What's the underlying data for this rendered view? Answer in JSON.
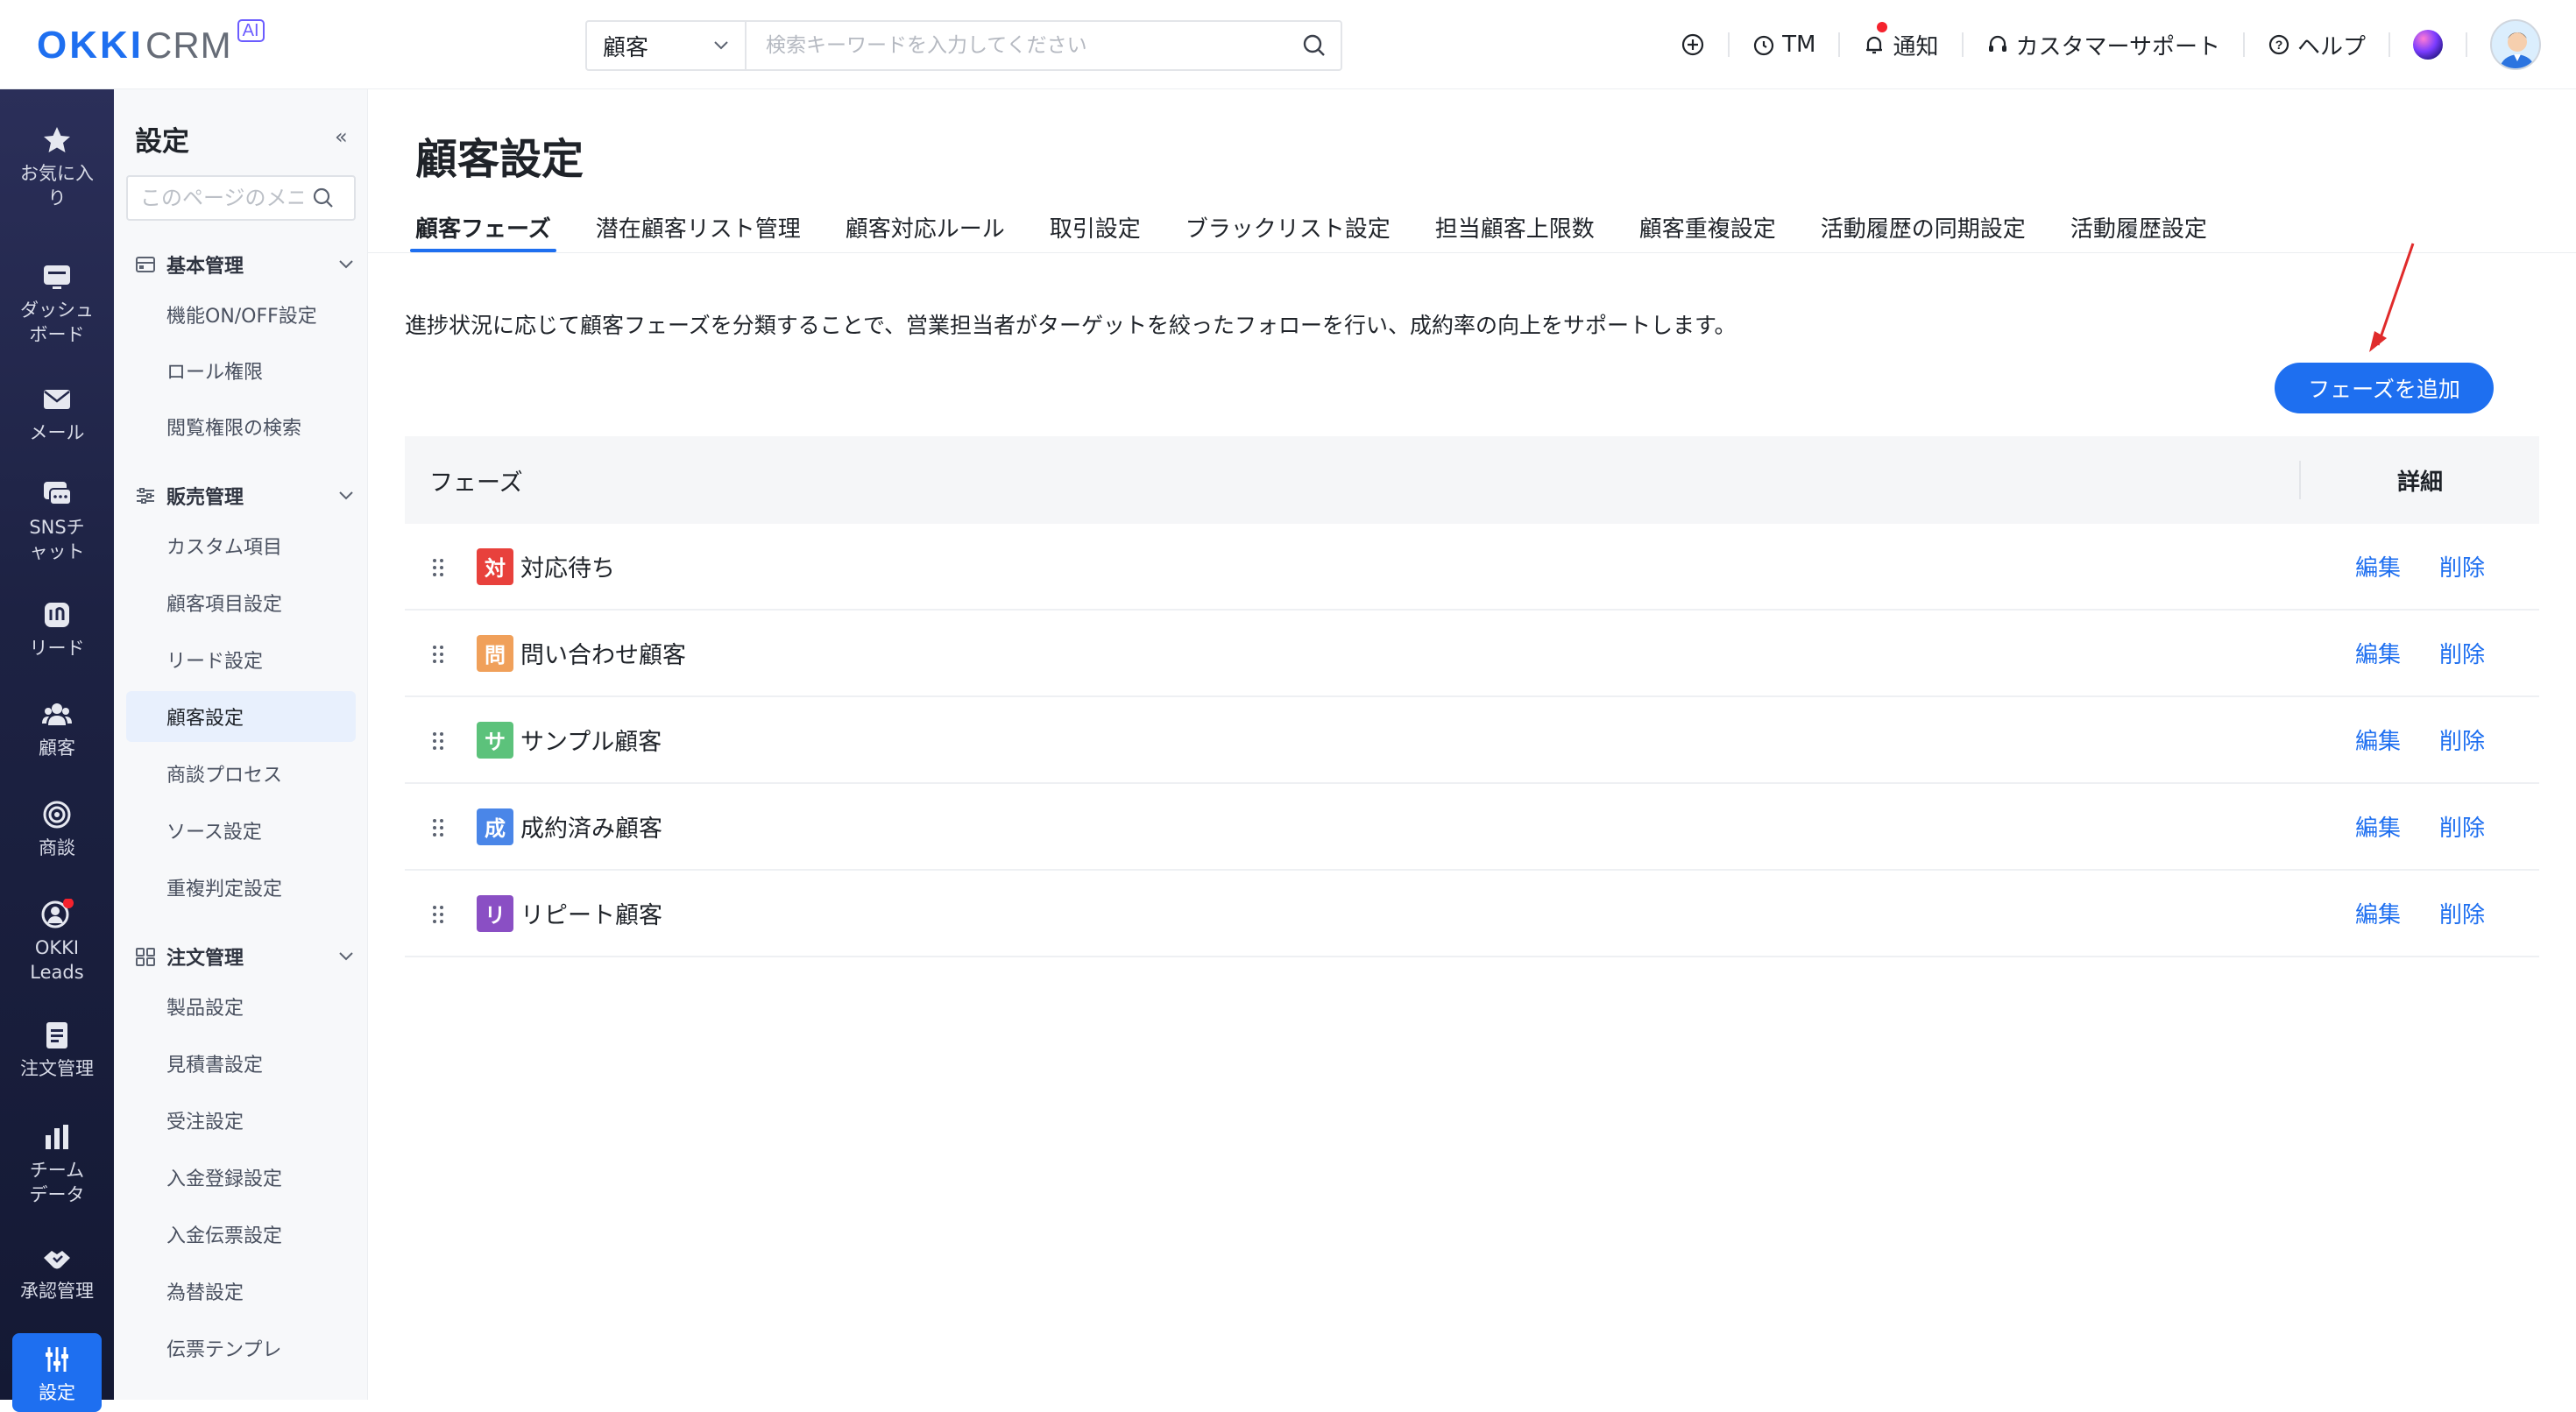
{
  "brand": {
    "okki": "OKKI",
    "crm": "CRM",
    "ai": "AI"
  },
  "search": {
    "type": "顧客",
    "placeholder": "検索キーワードを入力してください"
  },
  "top_actions": {
    "tm": "TM",
    "notify": "通知",
    "support": "カスタマーサポート",
    "help": "ヘルプ"
  },
  "leftnav": [
    {
      "label": "お気に入り",
      "icon": "star-icon"
    },
    {
      "label": "ダッシュボード",
      "icon": "dashboard-icon"
    },
    {
      "label": "メール",
      "icon": "mail-icon"
    },
    {
      "label": "SNSチャット",
      "icon": "chat-icon"
    },
    {
      "label": "リード",
      "icon": "lead-icon"
    },
    {
      "label": "顧客",
      "icon": "customers-icon"
    },
    {
      "label": "商談",
      "icon": "target-icon"
    },
    {
      "label": "OKKI Leads",
      "icon": "okki-leads-icon"
    },
    {
      "label": "注文管理",
      "icon": "order-icon"
    },
    {
      "label": "チームデータ",
      "icon": "team-data-icon"
    },
    {
      "label": "承認管理",
      "icon": "approval-icon"
    },
    {
      "label": "設定",
      "icon": "settings-icon"
    }
  ],
  "subnav": {
    "title": "設定",
    "search_placeholder": "このページのメニュー",
    "groups": [
      {
        "label": "基本管理",
        "items": [
          "機能ON/OFF設定",
          "ロール権限",
          "閲覧権限の検索"
        ]
      },
      {
        "label": "販売管理",
        "items": [
          "カスタム項目",
          "顧客項目設定",
          "リード設定",
          "顧客設定",
          "商談プロセス",
          "ソース設定",
          "重複判定設定"
        ]
      },
      {
        "label": "注文管理",
        "items": [
          "製品設定",
          "見積書設定",
          "受注設定",
          "入金登録設定",
          "入金伝票設定",
          "為替設定",
          "伝票テンプレ"
        ]
      }
    ],
    "active": "顧客設定"
  },
  "page": {
    "title": "顧客設定",
    "tabs": [
      "顧客フェーズ",
      "潜在顧客リスト管理",
      "顧客対応ルール",
      "取引設定",
      "ブラックリスト設定",
      "担当顧客上限数",
      "顧客重複設定",
      "活動履歴の同期設定",
      "活動履歴設定"
    ],
    "active_tab": "顧客フェーズ",
    "description": "進捗状況に応じて顧客フェーズを分類することで、営業担当者がターゲットを絞ったフォローを行い、成約率の向上をサポートします。",
    "add_button": "フェーズを追加"
  },
  "table": {
    "col_phase": "フェーズ",
    "col_detail": "詳細",
    "edit_label": "編集",
    "delete_label": "削除",
    "rows": [
      {
        "badge": "対",
        "name": "対応待ち",
        "color": "#e8413c"
      },
      {
        "badge": "問",
        "name": "問い合わせ顧客",
        "color": "#f0a05a"
      },
      {
        "badge": "サ",
        "name": "サンプル顧客",
        "color": "#5cc27b"
      },
      {
        "badge": "成",
        "name": "成約済み顧客",
        "color": "#4a86e8"
      },
      {
        "badge": "リ",
        "name": "リピート顧客",
        "color": "#8a4fc4"
      }
    ]
  }
}
